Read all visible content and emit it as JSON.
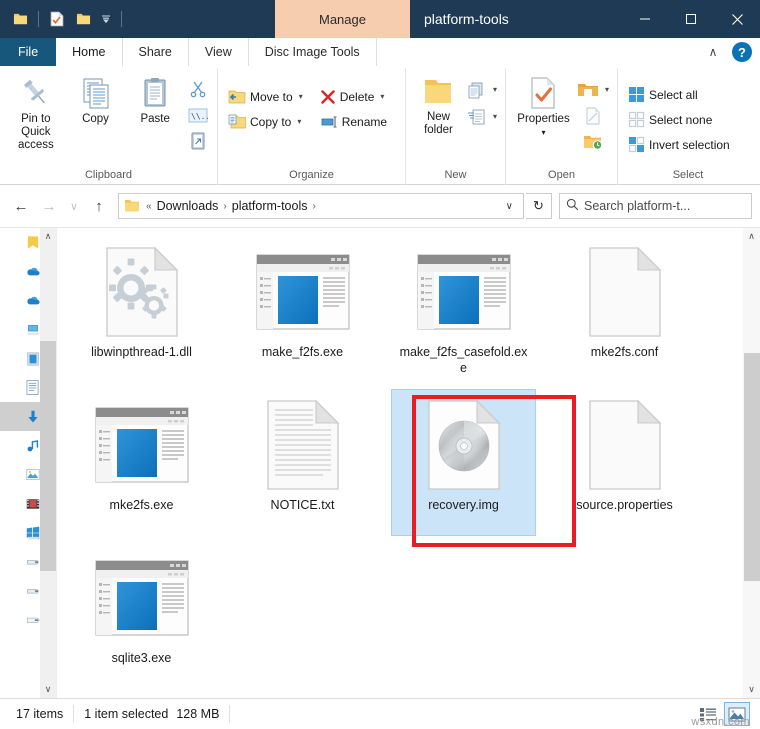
{
  "window": {
    "title": "platform-tools",
    "contextual_tab_header": "Manage",
    "minimize": "─",
    "maximize": "☐",
    "close": "✕"
  },
  "quick_access_toolbar": {
    "items": [
      {
        "name": "folder-icon",
        "label": ""
      },
      {
        "name": "properties-icon",
        "label": ""
      },
      {
        "name": "new-folder-icon",
        "label": ""
      }
    ],
    "customize_caret": "▾"
  },
  "tabs": [
    {
      "id": "file",
      "label": "File"
    },
    {
      "id": "home",
      "label": "Home"
    },
    {
      "id": "share",
      "label": "Share"
    },
    {
      "id": "view",
      "label": "View"
    },
    {
      "id": "disc-image-tools",
      "label": "Disc Image Tools"
    }
  ],
  "active_tab": "Home",
  "ribbon_right": {
    "collapse": "∧",
    "help": "?"
  },
  "ribbon": {
    "groups": [
      {
        "id": "clipboard",
        "label": "Clipboard",
        "big_buttons": [
          {
            "id": "pin-to-quick-access",
            "label": "Pin to Quick\naccess",
            "line1": "Pin to Quick",
            "line2": "access"
          },
          {
            "id": "copy",
            "label": "Copy",
            "line1": "Copy",
            "line2": ""
          },
          {
            "id": "paste",
            "label": "Paste",
            "line1": "Paste",
            "line2": ""
          }
        ],
        "small_buttons": [
          {
            "id": "cut",
            "label": "Cut"
          },
          {
            "id": "copy-path",
            "label": "Copy path"
          },
          {
            "id": "paste-shortcut",
            "label": "Paste shortcut"
          }
        ]
      },
      {
        "id": "organize",
        "label": "Organize",
        "small_buttons": [
          {
            "id": "move-to",
            "label": "Move to",
            "caret": "▾"
          },
          {
            "id": "copy-to",
            "label": "Copy to",
            "caret": "▾"
          },
          {
            "id": "delete",
            "label": "Delete",
            "caret": "▾"
          },
          {
            "id": "rename",
            "label": "Rename",
            "caret": ""
          }
        ]
      },
      {
        "id": "new",
        "label": "New",
        "big_buttons": [
          {
            "id": "new-folder",
            "line1": "New",
            "line2": "folder"
          }
        ],
        "small_buttons": [
          {
            "id": "new-item",
            "label": "",
            "caret": "▾"
          },
          {
            "id": "easy-access",
            "label": "",
            "caret": "▾"
          }
        ]
      },
      {
        "id": "open",
        "label": "Open",
        "big_buttons": [
          {
            "id": "properties",
            "line1": "Properties",
            "line2": "▾"
          }
        ],
        "small_buttons": [
          {
            "id": "open-with",
            "label": "",
            "caret": "▾"
          },
          {
            "id": "edit",
            "label": "",
            "caret": ""
          },
          {
            "id": "history",
            "label": "",
            "caret": ""
          }
        ]
      },
      {
        "id": "select",
        "label": "Select",
        "small_buttons": [
          {
            "id": "select-all",
            "label": "Select all"
          },
          {
            "id": "select-none",
            "label": "Select none"
          },
          {
            "id": "invert-selection",
            "label": "Invert selection"
          }
        ]
      }
    ]
  },
  "address_bar": {
    "back": "←",
    "forward": "→",
    "recent_caret": "∨",
    "up": "↑",
    "breadcrumb": {
      "prefix": "«",
      "segments": [
        "Downloads",
        "platform-tools"
      ],
      "separator": "›",
      "trailing_separator": "›",
      "dropdown": "∨"
    },
    "refresh": "↻",
    "search_placeholder": "Search platform-t...",
    "search_value": ""
  },
  "nav_pane": {
    "items": [
      {
        "id": "quick-access",
        "icon": "quick-access-folder-icon",
        "selected": false
      },
      {
        "id": "onedrive-personal",
        "icon": "onedrive-cloud-icon",
        "selected": false
      },
      {
        "id": "onedrive-work",
        "icon": "onedrive-cloud-icon",
        "selected": false
      },
      {
        "id": "this-pc",
        "icon": "this-pc-icon",
        "selected": false
      },
      {
        "id": "3d-objects",
        "icon": "3d-objects-icon",
        "selected": false
      },
      {
        "id": "documents",
        "icon": "documents-icon",
        "selected": false
      },
      {
        "id": "downloads",
        "icon": "downloads-icon",
        "selected": true
      },
      {
        "id": "music",
        "icon": "music-icon",
        "selected": false
      },
      {
        "id": "pictures",
        "icon": "pictures-icon",
        "selected": false
      },
      {
        "id": "videos",
        "icon": "videos-icon",
        "selected": false
      },
      {
        "id": "windows-c",
        "icon": "windows-drive-icon",
        "selected": false
      },
      {
        "id": "usb-drive-1",
        "icon": "usb-drive-icon",
        "selected": false
      },
      {
        "id": "usb-drive-2",
        "icon": "usb-drive-icon",
        "selected": false
      },
      {
        "id": "external-drive",
        "icon": "external-drive-icon",
        "selected": false
      }
    ],
    "scroll_up": "∧",
    "scroll_down": "∨"
  },
  "files": [
    {
      "name": "libwinpthread-1.dll",
      "icon": "dll-gears-icon",
      "selected": false
    },
    {
      "name": "make_f2fs.exe",
      "icon": "exe-app-icon",
      "selected": false
    },
    {
      "name": "make_f2fs_casefold.exe",
      "icon": "exe-app-icon",
      "selected": false
    },
    {
      "name": "mke2fs.conf",
      "icon": "blank-file-icon",
      "selected": false
    },
    {
      "name": "mke2fs.exe",
      "icon": "exe-app-icon",
      "selected": false
    },
    {
      "name": "NOTICE.txt",
      "icon": "text-file-icon",
      "selected": false
    },
    {
      "name": "recovery.img",
      "icon": "disc-image-icon",
      "selected": true
    },
    {
      "name": "source.properties",
      "icon": "blank-file-icon",
      "selected": false
    },
    {
      "name": "sqlite3.exe",
      "icon": "exe-app-icon",
      "selected": false
    }
  ],
  "highlight": {
    "target": "recovery.img",
    "color": "#ec1c24"
  },
  "status_bar": {
    "item_count": "17 items",
    "selection_info": "1 item selected",
    "selection_size": "128 MB",
    "view_buttons": [
      {
        "id": "details-view",
        "active": false
      },
      {
        "id": "large-icons-view",
        "active": true
      }
    ]
  },
  "watermark": "wsxdn.com",
  "colors": {
    "titlebar": "#1f3a54",
    "file_tab": "#17577c",
    "contextual": "#f7cdb0",
    "selection": "#cce4f7",
    "highlight": "#ec1c24",
    "accent_blue": "#0b72b5"
  }
}
